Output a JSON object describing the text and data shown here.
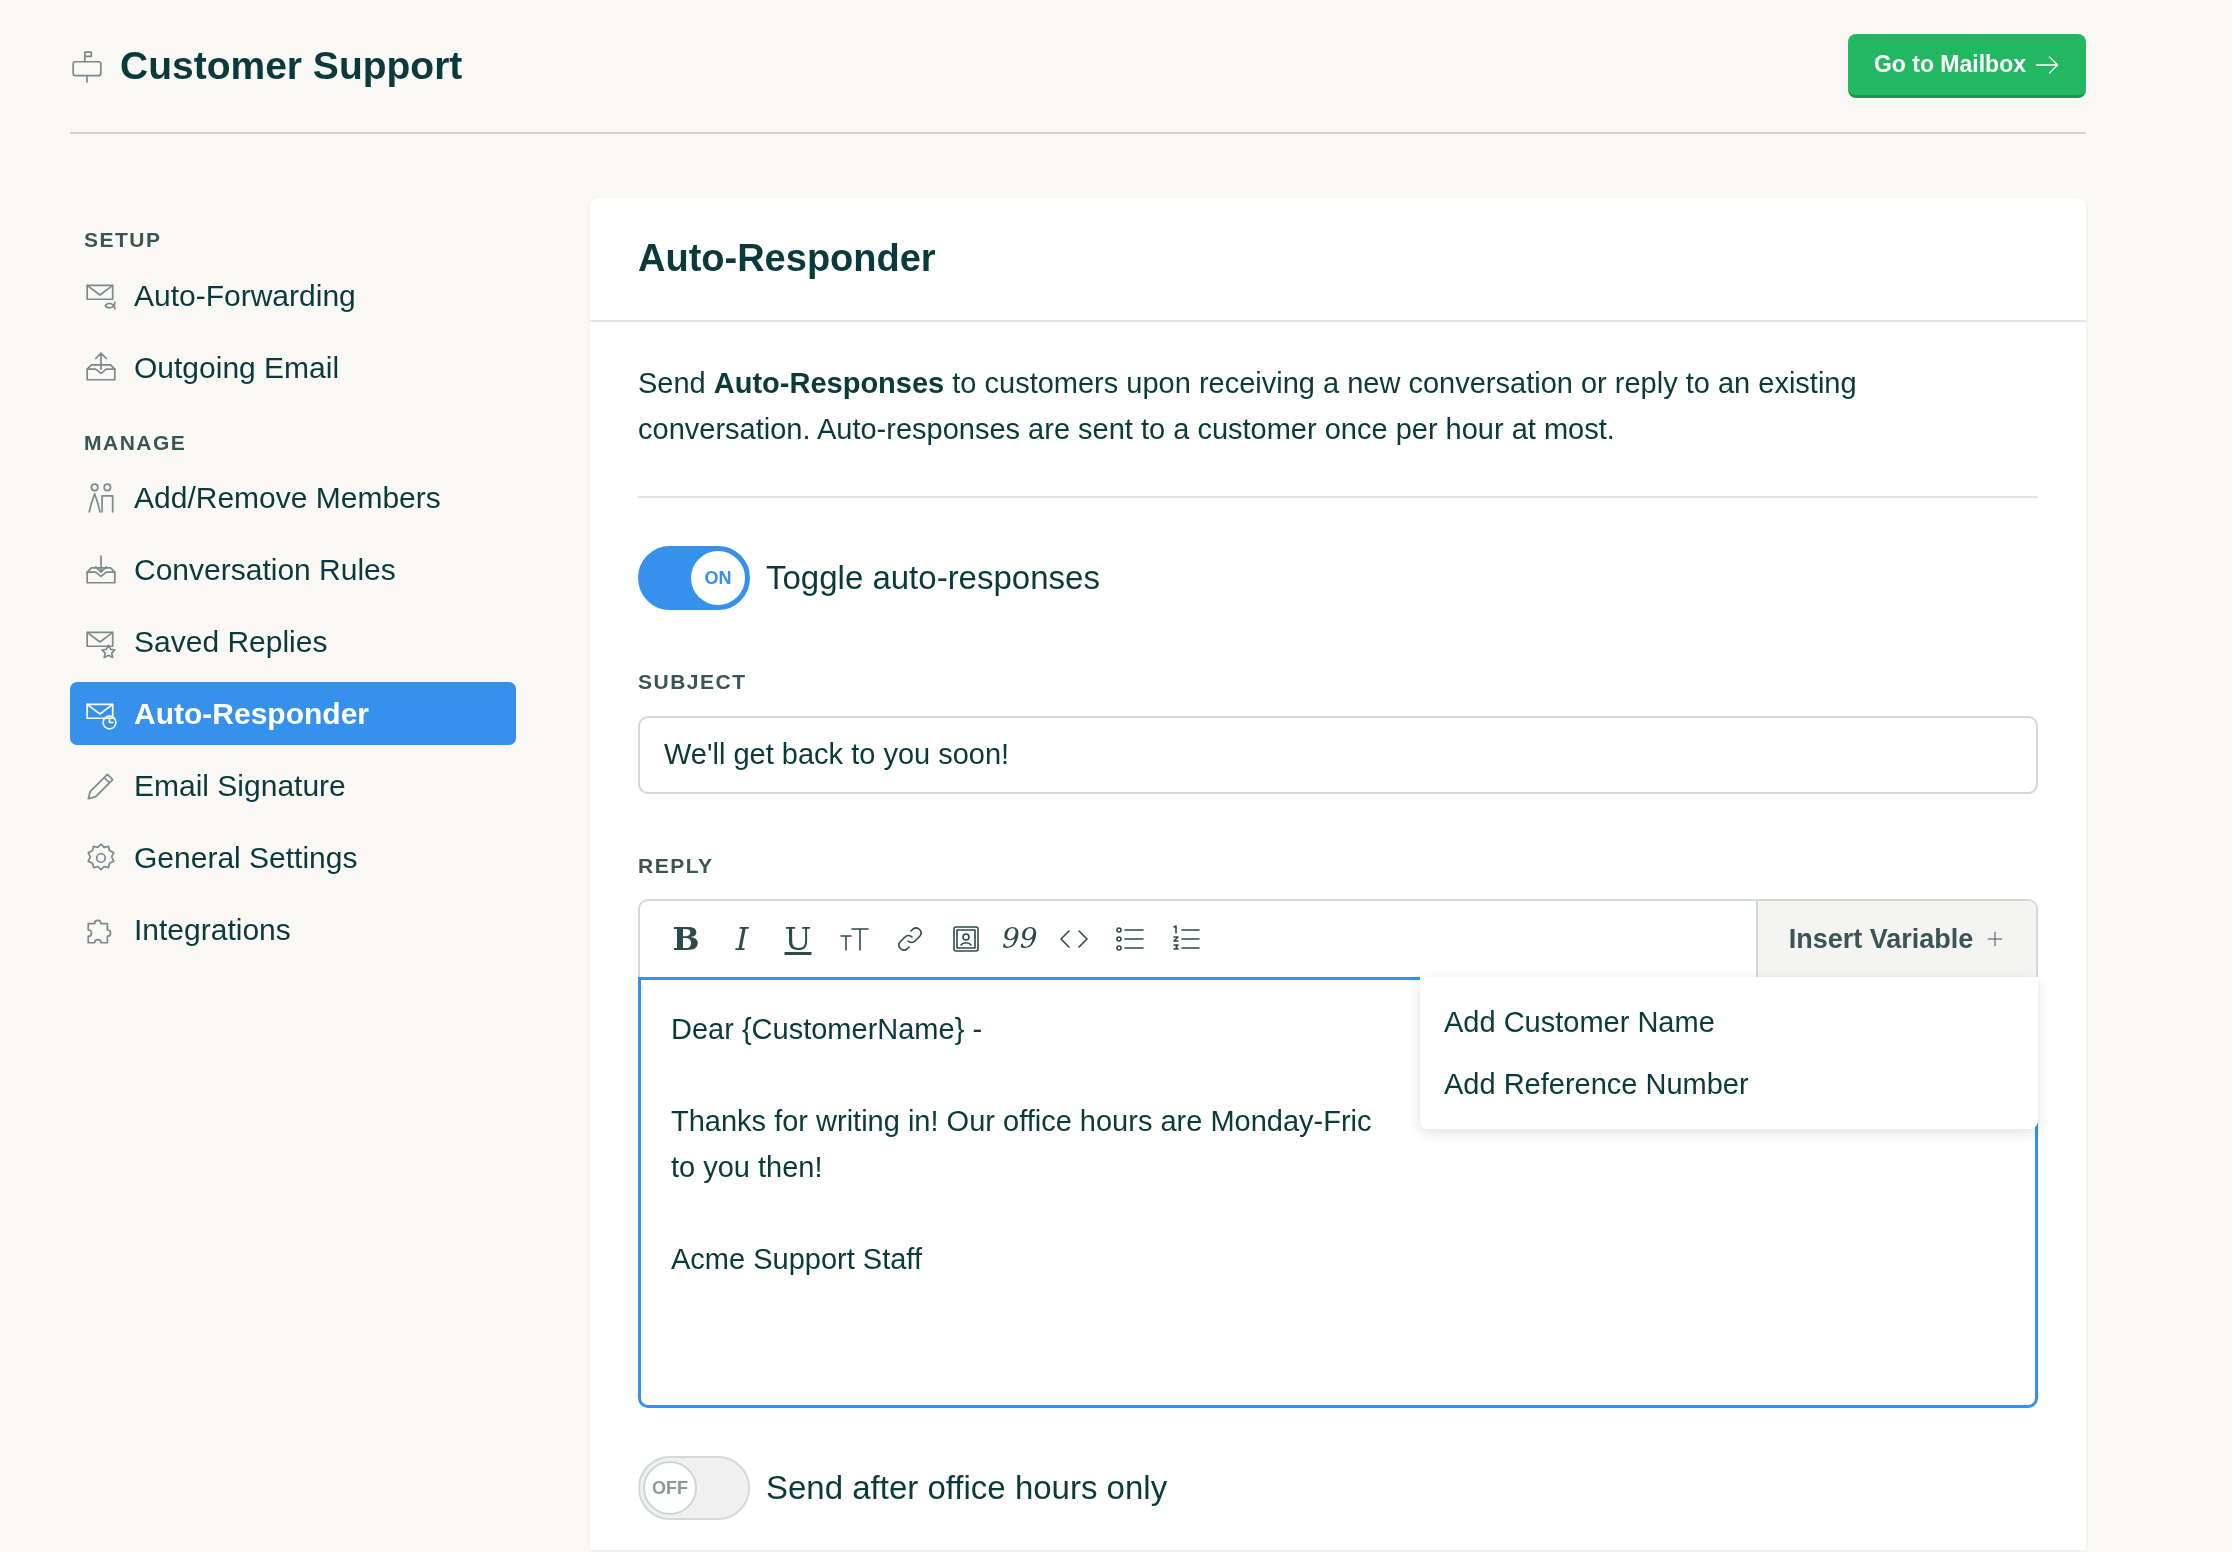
{
  "header": {
    "title": "Customer Support",
    "button": "Go to Mailbox"
  },
  "sidebar": {
    "sections": [
      {
        "title": "SETUP",
        "items": [
          {
            "label": "Auto-Forwarding",
            "selected": false
          },
          {
            "label": "Outgoing Email",
            "selected": false
          }
        ]
      },
      {
        "title": "MANAGE",
        "items": [
          {
            "label": "Add/Remove Members",
            "selected": false
          },
          {
            "label": "Conversation Rules",
            "selected": false
          },
          {
            "label": "Saved Replies",
            "selected": false
          },
          {
            "label": "Auto-Responder",
            "selected": true
          },
          {
            "label": "Email Signature",
            "selected": false
          },
          {
            "label": "General Settings",
            "selected": false
          },
          {
            "label": "Integrations",
            "selected": false
          }
        ]
      }
    ]
  },
  "panel": {
    "title": "Auto-Responder",
    "description": "Send **Auto-Responses** to customers upon receiving a new conversation or reply to an existing conversation. Auto-responses are sent to a customer once per hour at most.",
    "auto_toggle": {
      "label": "Toggle auto-responses",
      "on": true,
      "knob_text": "ON"
    },
    "subject": {
      "label": "SUBJECT",
      "value": "We'll get back to you soon!"
    },
    "reply": {
      "label": "REPLY",
      "toolbar": [
        {
          "kind": "bold",
          "glyph": "B"
        },
        {
          "kind": "italic",
          "glyph": "I"
        },
        {
          "kind": "underline",
          "glyph": "U"
        },
        {
          "kind": "textsize"
        },
        {
          "kind": "link"
        },
        {
          "kind": "image"
        },
        {
          "kind": "quote",
          "glyph": "99"
        },
        {
          "kind": "code"
        },
        {
          "kind": "bullets"
        },
        {
          "kind": "numbers"
        }
      ],
      "insert_button": "Insert Variable",
      "menu": [
        "Add Customer Name",
        "Add Reference Number"
      ],
      "paragraphs": [
        [
          "Dear {CustomerName} -"
        ],
        [
          "Thanks for writing in! Our office hours are Monday-Fric",
          "to you then!"
        ],
        [
          "Acme Support Staff"
        ]
      ]
    },
    "office_toggle": {
      "label": "Send after office hours only",
      "on": false,
      "knob_text": "OFF"
    }
  }
}
